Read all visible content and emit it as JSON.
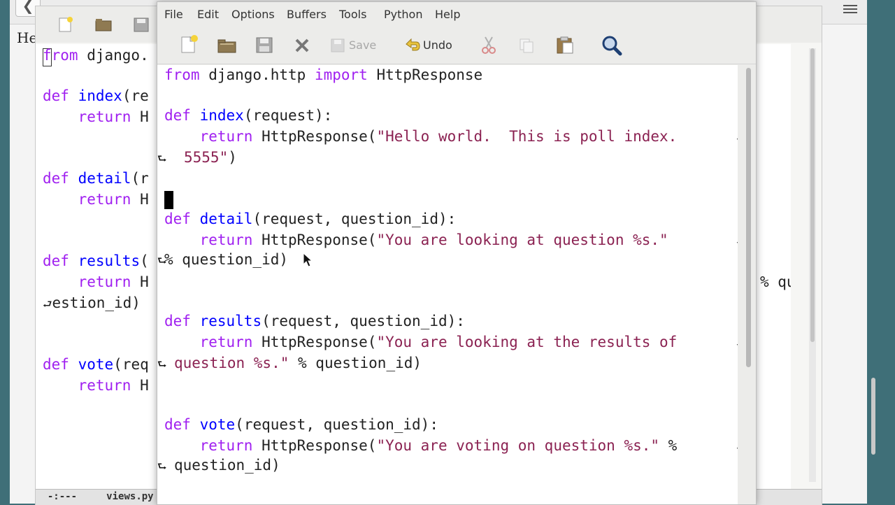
{
  "browser": {
    "back_glyph": "❮",
    "page_heading": "He"
  },
  "back_emacs": {
    "lines": [
      "from django.",
      "def index(re",
      "    return H",
      "def detail(r",
      "    return H",
      "def results(",
      "    return H",
      "estion_id)",
      "def vote(req",
      "    return H"
    ],
    "right_fragment": "% qu",
    "modeline_status": "-:---",
    "modeline_buffer": "views.py"
  },
  "menu": {
    "file": "File",
    "edit": "Edit",
    "options": "Options",
    "buffers": "Buffers",
    "tools": "Tools",
    "python": "Python",
    "help": "Help"
  },
  "toolbar": {
    "save_label": "Save",
    "undo_label": "Undo"
  },
  "code": {
    "l1_kw": "from",
    "l1_mod": " django.http ",
    "l1_kw2": "import",
    "l1_rest": " HttpResponse",
    "index_def": "def",
    "index_name": "index",
    "index_args": "(request):",
    "index_ret": "return",
    "index_call": " HttpResponse(",
    "index_str": "\"Hello world.  This is poll index.",
    "index_str2": "5555\"",
    "index_close": ")",
    "detail_def": "def",
    "detail_name": "detail",
    "detail_args": "(request, question_id):",
    "detail_ret": "return",
    "detail_call": " HttpResponse(",
    "detail_str": "\"You are looking at question %s.\"",
    "detail_cont": "% question_id)",
    "results_def": "def",
    "results_name": "results",
    "results_args": "(request, question_id):",
    "results_ret": "return",
    "results_call": " HttpResponse(",
    "results_str": "\"You are looking at the results of",
    "results_str2": "question %s.\"",
    "results_cont": " % question_id)",
    "vote_def": "def",
    "vote_name": "vote",
    "vote_args": "(request, question_id):",
    "vote_ret": "return",
    "vote_call": " HttpResponse(",
    "vote_str": "\"You are voting on question %s.\"",
    "vote_pct": " %",
    "vote_cont": "question_id)"
  },
  "colors": {
    "keyword": "#a020f0",
    "function": "#0000ff",
    "string": "#8b2252"
  }
}
